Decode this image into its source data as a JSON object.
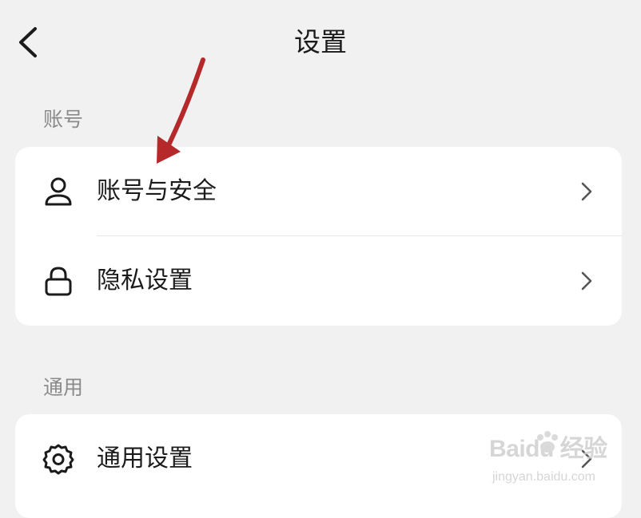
{
  "header": {
    "title": "设置",
    "back_icon": "chevron-left-icon"
  },
  "sections": [
    {
      "label": "账号",
      "items": [
        {
          "label": "账号与安全",
          "icon": "person-icon"
        },
        {
          "label": "隐私设置",
          "icon": "lock-icon"
        }
      ]
    },
    {
      "label": "通用",
      "items": [
        {
          "label": "通用设置",
          "icon": "gear-icon"
        }
      ]
    }
  ],
  "annotation": {
    "arrow_color": "#b5292b",
    "points_to": "账号与安全"
  },
  "watermark": {
    "brand": "Baidu 经验",
    "url": "jingyan.baidu.com"
  },
  "colors": {
    "background": "#f1f1f1",
    "card": "#ffffff",
    "section_label": "#8a8a8a",
    "text": "#1b1b1b"
  }
}
